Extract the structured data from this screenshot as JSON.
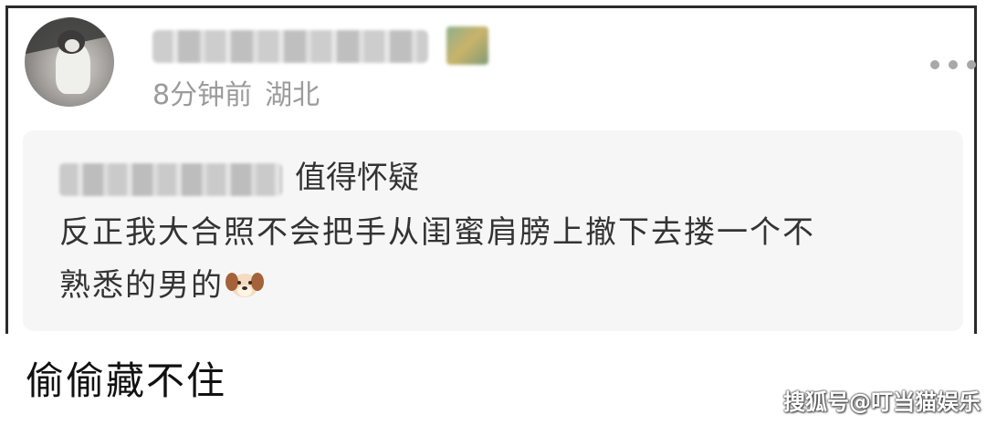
{
  "post": {
    "time": "8分钟前",
    "location": "湖北"
  },
  "quote": {
    "line1": "值得怀疑",
    "line2": "反正我大合照不会把手从闺蜜肩膀上撤下去搂一个不",
    "line3": "熟悉的男的",
    "emoji": "dog-face-emoji"
  },
  "caption": "偷偷藏不住",
  "watermark": "搜狐号@叮当猫娱乐",
  "colors": {
    "frame": "#2b2b2b",
    "meta_text": "#9b9b9b",
    "quote_bg": "#f6f6f6",
    "body_text": "#333333",
    "more_dots": "#a8a8a8"
  },
  "icons": {
    "more": "more-horizontal-icon",
    "avatar": "cat-avatar"
  }
}
